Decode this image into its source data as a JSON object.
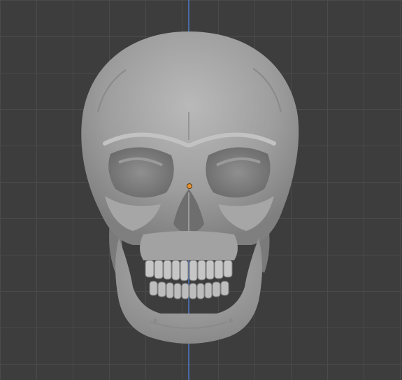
{
  "viewport": {
    "mode": "object",
    "view": "front-orthographic",
    "grid": true,
    "background_color": "#3d3d3d",
    "grid_color": "#4a4a4a",
    "axis_color": "#4a6fb0",
    "object": {
      "type": "mesh",
      "depicts": "human-skull",
      "color": "#a8a8a8",
      "origin_color": "#e8912e"
    }
  }
}
